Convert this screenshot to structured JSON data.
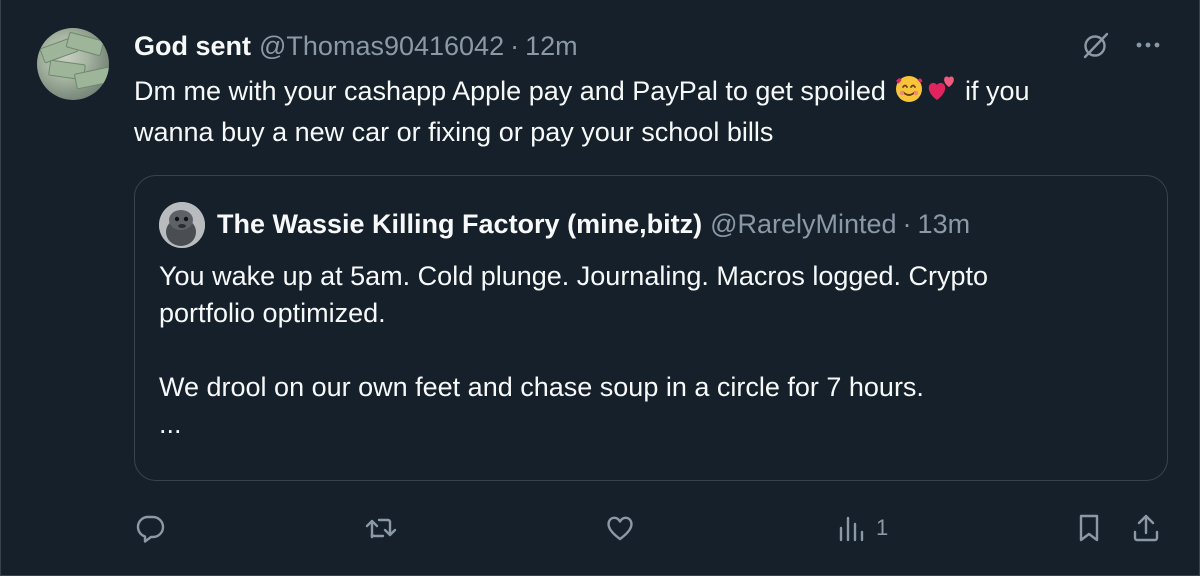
{
  "tweet": {
    "author_name": "God sent",
    "handle": "@Thomas90416042",
    "separator": "·",
    "time": "12m",
    "text_line1_before": "Dm me with your cashapp  Apple pay and PayPal to get spoiled ",
    "text_line1_after": " if you",
    "text_line2": "wanna buy a new car or fixing or pay your school bills",
    "emojis": [
      "smiling-face-with-hearts-emoji",
      "two-hearts-emoji"
    ]
  },
  "quote": {
    "author_name": "The Wassie Killing Factory (mine,bitz)",
    "handle": "@RarelyMinted",
    "separator": "·",
    "time": "13m",
    "lines": [
      "You wake up at 5am. Cold plunge. Journaling. Macros logged. Crypto",
      "portfolio optimized.",
      "We drool on our own feet and chase soup in a circle for 7 hours.",
      "..."
    ]
  },
  "actions": {
    "reply_icon": "reply-icon",
    "retweet_icon": "retweet-icon",
    "like_icon": "heart-icon",
    "views_icon": "views-chart-icon",
    "views_count": "1",
    "bookmark_icon": "bookmark-icon",
    "share_icon": "share-icon"
  },
  "colors": {
    "background": "#15202b",
    "text_primary": "#f7f9f9",
    "text_secondary": "#8b98a5",
    "border": "#38444d"
  }
}
